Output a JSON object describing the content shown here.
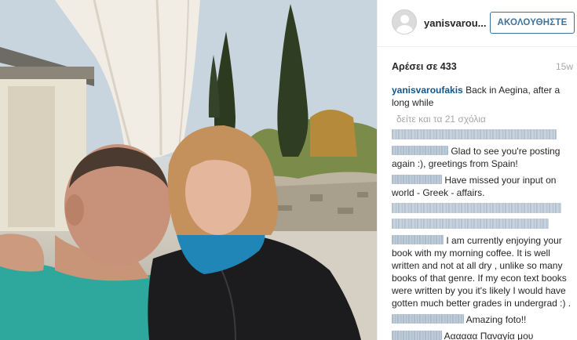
{
  "post": {
    "username": "yanisvarou...",
    "follow_label": "ΑΚΟΛΟΥΘΗΣΤΕ",
    "likes_label": "Αρέσει σε 433",
    "age": "15w"
  },
  "caption": {
    "user": "yanisvaroufakis",
    "text": "Back in Aegina, after a long while"
  },
  "view_all_label": "δείτε και τα 21 σχόλια",
  "comments": [
    {
      "text": "Glad to see you're posting again :), greetings from Spain!"
    },
    {
      "text": "Have missed your input on world - Greek - affairs."
    },
    {
      "text": "I am currently enjoying your book with my morning coffee. It is well written and not at all dry , unlike so many books of that genre. If my econ text books were written by you it's likely I would have gotten much better grades in undergrad :) ."
    },
    {
      "text": "Amazing foto!!"
    },
    {
      "text": "Αααααα Παναγία μου"
    }
  ],
  "icons": {
    "avatar": "user-silhouette-icon"
  }
}
